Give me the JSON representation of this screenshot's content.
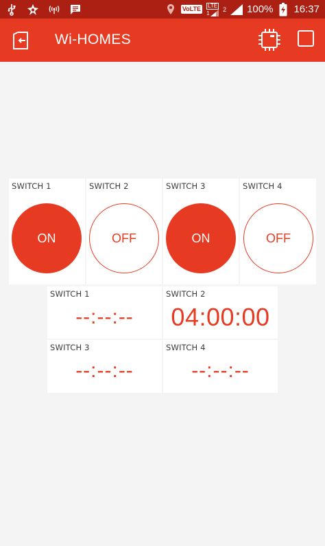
{
  "status_bar": {
    "volte": "VoLTE",
    "lte": "LTE",
    "sim1": "1",
    "sim2": "2",
    "battery": "100%",
    "time": "16:37"
  },
  "app_bar": {
    "title": "Wi-HOMES"
  },
  "switches": [
    {
      "label": "SWITCH 1",
      "state": "ON"
    },
    {
      "label": "SWITCH 2",
      "state": "OFF"
    },
    {
      "label": "SWITCH 3",
      "state": "ON"
    },
    {
      "label": "SWITCH 4",
      "state": "OFF"
    }
  ],
  "timers": [
    {
      "label": "SWITCH 1",
      "value": "--:--:--"
    },
    {
      "label": "SWITCH 2",
      "value": "04:00:00"
    },
    {
      "label": "SWITCH 3",
      "value": "--:--:--"
    },
    {
      "label": "SWITCH 4",
      "value": "--:--:--"
    }
  ],
  "colors": {
    "status_bar": "#ac1f13",
    "accent": "#e73a22",
    "background": "#f4f4f4",
    "card": "#ffffff"
  },
  "icons": {
    "app_back": "exit-door-icon",
    "chip": "chip-icon",
    "square": "square-icon"
  }
}
